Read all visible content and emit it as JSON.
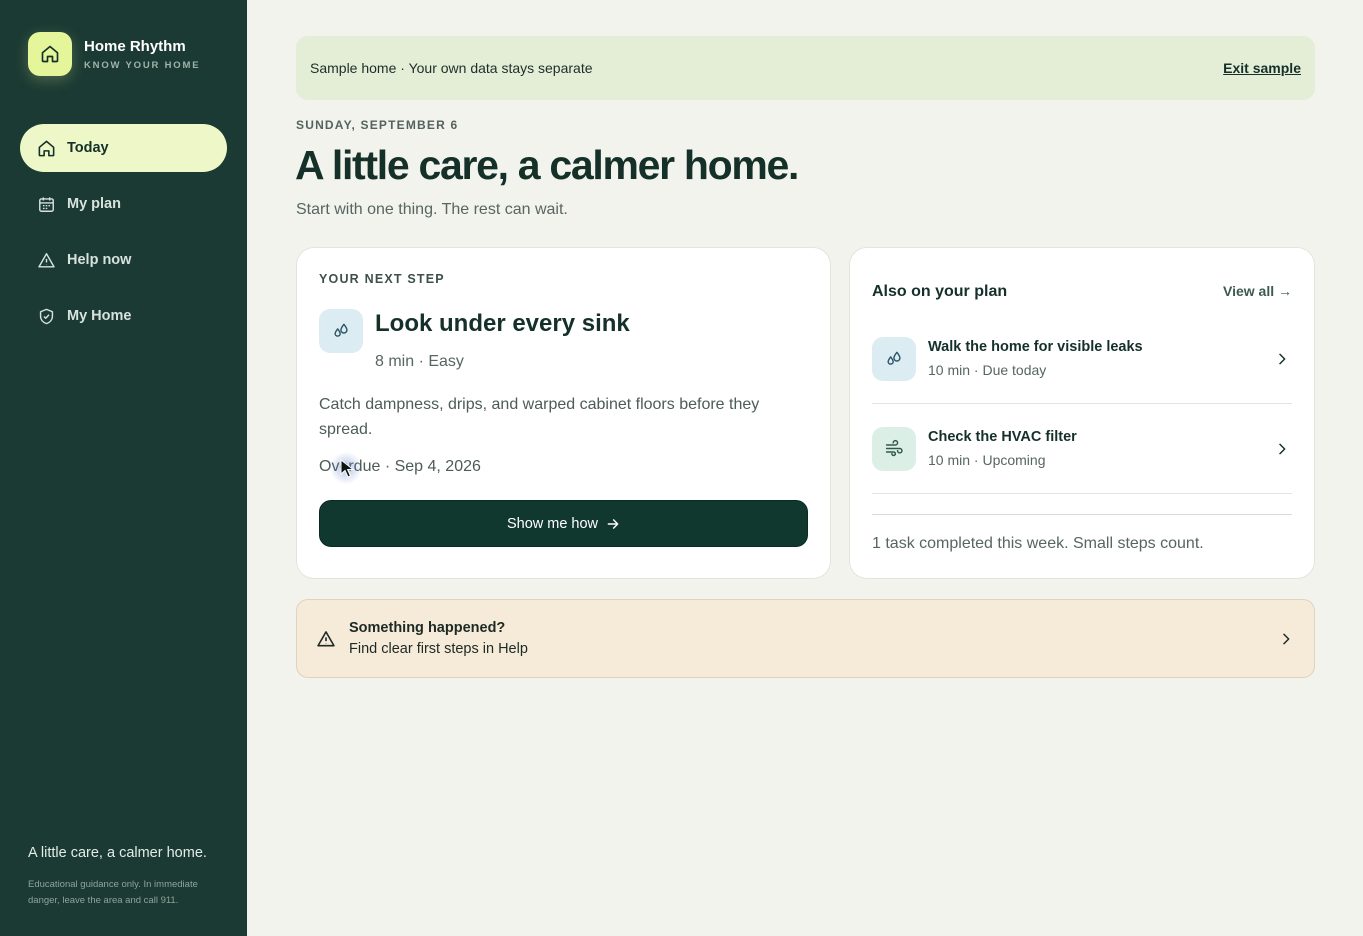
{
  "brand": {
    "name": "Home Rhythm",
    "tagline": "KNOW YOUR HOME",
    "logo_icon": "house-icon",
    "accent": "#e4f59a"
  },
  "sidebar": {
    "items": [
      {
        "label": "Today",
        "icon": "house-icon",
        "active": true
      },
      {
        "label": "My plan",
        "icon": "calendar-icon",
        "active": false
      },
      {
        "label": "Help now",
        "icon": "warning-triangle-icon",
        "active": false
      },
      {
        "label": "My Home",
        "icon": "shield-check-icon",
        "active": false
      }
    ],
    "quote": "A little care, a calmer home.",
    "disclaimer": "Educational guidance only. In immediate danger, leave the area and call 911."
  },
  "banner": {
    "text": "Sample home · Your own data stays separate",
    "action": "Exit sample"
  },
  "header": {
    "date": "SUNDAY, SEPTEMBER 6",
    "title": "A little care, a calmer home.",
    "subtitle": "Start with one thing. The rest can wait."
  },
  "next_step": {
    "eyebrow": "YOUR NEXT STEP",
    "icon": "water-drops-icon",
    "title": "Look under every sink",
    "meta": "8 min · Easy",
    "description": "Catch dampness, drips, and warped cabinet floors before they spread.",
    "due": "Overdue · Sep 4, 2026",
    "button": "Show me how"
  },
  "plan": {
    "title": "Also on your plan",
    "view_all": "View all →",
    "items": [
      {
        "name": "Walk the home for visible leaks",
        "meta": "10 min · Due today",
        "icon": "water-drops-icon",
        "icon_bg": "#dcecf3"
      },
      {
        "name": "Check the HVAC filter",
        "meta": "10 min · Upcoming",
        "icon": "wind-icon",
        "icon_bg": "#dcefe6"
      }
    ],
    "footer": "1 task completed this week. Small steps count."
  },
  "help": {
    "title": "Something happened?",
    "subtitle": "Find clear first steps in Help",
    "icon": "warning-triangle-icon"
  },
  "colors": {
    "sidebar_bg": "#1b3a33",
    "primary": "#11382f",
    "banner_bg": "#e4eed7",
    "help_bg": "#f6ebd9"
  }
}
